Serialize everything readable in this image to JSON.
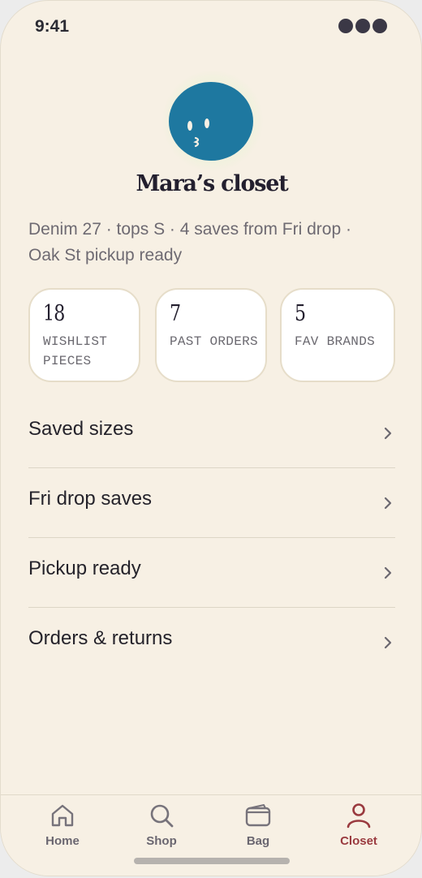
{
  "status_bar": {
    "time": "9:41"
  },
  "profile": {
    "name": "Mara’s closet",
    "summary": "Denim 27 · tops S · 4 saves from Fri drop · Oak St pickup ready"
  },
  "stats": [
    {
      "value": "18",
      "label": "WISHLIST PIECES"
    },
    {
      "value": "7",
      "label": "PAST ORDERS"
    },
    {
      "value": "5",
      "label": "FAV BRANDS"
    }
  ],
  "menu": [
    {
      "label": "Saved sizes"
    },
    {
      "label": "Fri drop saves"
    },
    {
      "label": "Pickup ready"
    },
    {
      "label": "Orders & returns"
    }
  ],
  "tabs": [
    {
      "label": "Home",
      "icon": "home-icon",
      "active": false
    },
    {
      "label": "Shop",
      "icon": "search-icon",
      "active": false
    },
    {
      "label": "Bag",
      "icon": "wallet-icon",
      "active": false
    },
    {
      "label": "Closet",
      "icon": "user-icon",
      "active": true
    }
  ],
  "colors": {
    "background": "#f7f0e4",
    "avatar": "#1e78a0",
    "active_tab": "#9a3a3f",
    "text": "#231f2e"
  }
}
